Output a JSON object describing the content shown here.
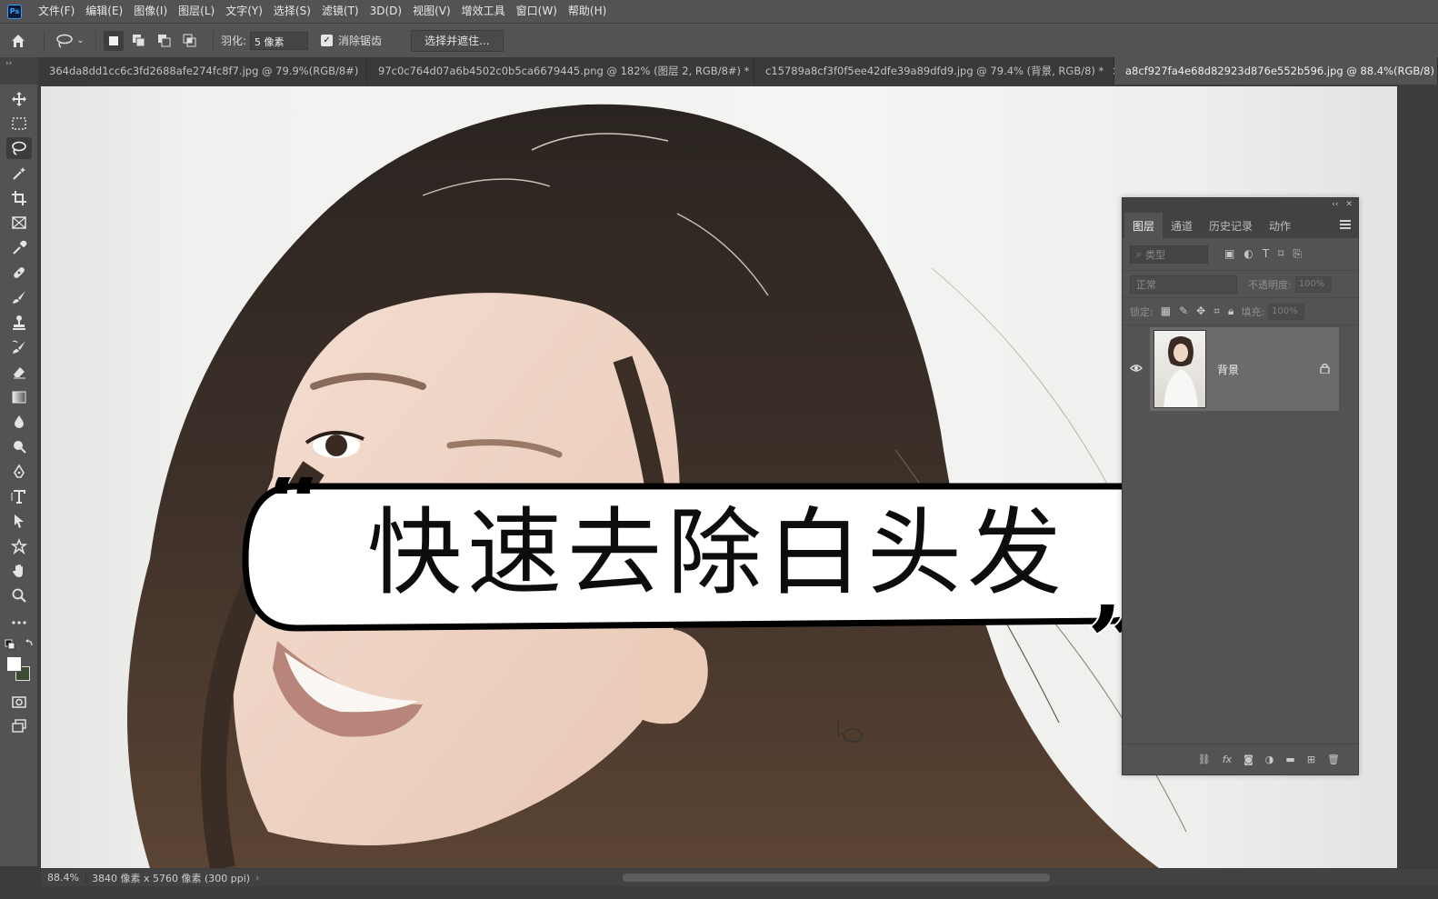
{
  "app": {
    "logo": "Ps"
  },
  "menu": {
    "items": [
      "文件(F)",
      "编辑(E)",
      "图像(I)",
      "图层(L)",
      "文字(Y)",
      "选择(S)",
      "滤镜(T)",
      "3D(D)",
      "视图(V)",
      "增效工具",
      "窗口(W)",
      "帮助(H)"
    ]
  },
  "options": {
    "feather_label": "羽化:",
    "feather_value": "5 像素",
    "antialias_label": "消除锯齿",
    "antialias_checked": true,
    "select_mask_label": "选择并遮住..."
  },
  "tabs": [
    {
      "label": "364da8dd1cc6c3fd2688afe274fc8f7.jpg @ 79.9%(RGB/8#)",
      "close": "×"
    },
    {
      "label": "97c0c764d07a6b4502c0b5ca6679445.png @ 182% (图层 2, RGB/8#) *",
      "close": "×"
    },
    {
      "label": "c15789a8cf3f0f5ee42dfe39a89dfd9.jpg @ 79.4% (背景, RGB/8) *",
      "close": "×"
    },
    {
      "label": "a8cf927fa4e68d82923d876e552b596.jpg @ 88.4%(RGB/8) *",
      "close": ""
    }
  ],
  "title_overlay": {
    "text": "快速去除白头发"
  },
  "layers_panel": {
    "tabs": [
      "图层",
      "通道",
      "历史记录",
      "动作"
    ],
    "kind_placeholder": "类型",
    "blend_mode": "正常",
    "opacity_label": "不透明度:",
    "opacity_value": "100%",
    "lock_label": "锁定:",
    "fill_label": "填充:",
    "fill_value": "100%",
    "layer": {
      "name": "背景"
    }
  },
  "status": {
    "zoom": "88.4%",
    "doc_size": "3840 像素 x 5760 像素 (300 ppi)",
    "arrow": "›"
  },
  "colors": {
    "ui_dark": "#535353",
    "ui_darker": "#424242",
    "accent": "#31a8ff",
    "title_text": "#0d0d0d"
  }
}
